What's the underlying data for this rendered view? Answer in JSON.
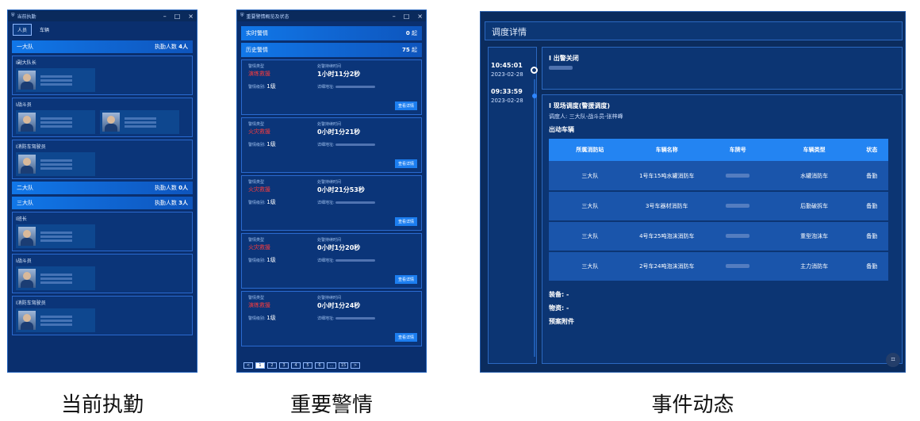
{
  "captions": [
    "当前执勤",
    "重要警情",
    "事件动态"
  ],
  "duty": {
    "title": "当前执勤",
    "controls": [
      "–",
      "□",
      "×"
    ],
    "tabs": [
      "人员",
      "车辆"
    ],
    "groups": [
      {
        "name": "一大队",
        "count_label": "执勤人数",
        "count": "4人"
      },
      {
        "name": "二大队",
        "count_label": "执勤人数",
        "count": "0人"
      },
      {
        "name": "三大队",
        "count_label": "执勤人数",
        "count": "3人"
      }
    ],
    "cards": [
      "I副大队长",
      "I战斗员",
      "I消防车驾驶员",
      "I班长",
      "I战斗员",
      "I消防车驾驶员"
    ]
  },
  "alerts": {
    "title": "重要警情概览及状态",
    "realtime": {
      "label": "实时警情",
      "count": "0",
      "unit": "起"
    },
    "history": {
      "label": "历史警情",
      "count": "75",
      "unit": "起"
    },
    "type_label": "警情类型",
    "time_label": "处警持续时间",
    "level_label": "警情级别:",
    "addr_label": "详细地址:",
    "detail_btn": "查看详情",
    "items": [
      {
        "type": "演练救援",
        "time": "1小时11分2秒",
        "level": "1级"
      },
      {
        "type": "火灾救援",
        "time": "0小时1分21秒",
        "level": "1级"
      },
      {
        "type": "火灾救援",
        "time": "0小时21分53秒",
        "level": "1级"
      },
      {
        "type": "火灾救援",
        "time": "0小时1分20秒",
        "level": "1级"
      },
      {
        "type": "演练救援",
        "time": "0小时1分24秒",
        "level": "1级"
      }
    ],
    "pager": [
      "<",
      "1",
      "2",
      "3",
      "4",
      "5",
      "6",
      "…",
      "15",
      ">"
    ]
  },
  "event": {
    "header": "调度详情",
    "timeline": [
      {
        "time": "10:45:01",
        "date": "2023-02-28"
      },
      {
        "time": "09:33:59",
        "date": "2023-02-28"
      }
    ],
    "sec1_title": "I 出警关闭",
    "sec2_title": "I 现场调度(警援调度)",
    "dispatcher": "调度人: 三大队-战斗员-张梓峰",
    "vehicles_label": "出动车辆",
    "columns": [
      "所属消防站",
      "车辆名称",
      "车牌号",
      "车辆类型",
      "状态"
    ],
    "rows": [
      [
        "三大队",
        "1号车15吨水罐消防车",
        "水罐消防车",
        "备勤"
      ],
      [
        "三大队",
        "3号车器材消防车",
        "后勤破拆车",
        "备勤"
      ],
      [
        "三大队",
        "4号车25吨泡沫消防车",
        "重型泡沫车",
        "备勤"
      ],
      [
        "三大队",
        "2号车24吨泡沫消防车",
        "主力消防车",
        "备勤"
      ]
    ],
    "equip": "装备:  -",
    "material": "物资:  -",
    "attach": "预案附件"
  }
}
